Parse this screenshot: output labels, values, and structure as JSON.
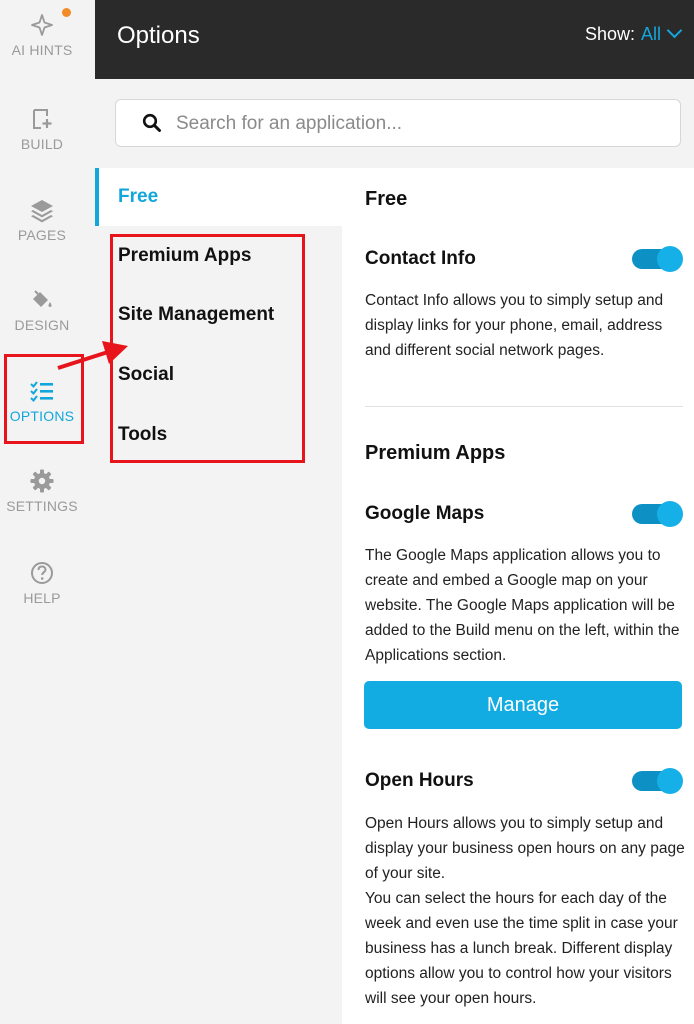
{
  "rail": {
    "items": [
      {
        "label": "AI HINTS",
        "icon": "sparkle-icon"
      },
      {
        "label": "BUILD",
        "icon": "build-plus-icon"
      },
      {
        "label": "PAGES",
        "icon": "layers-icon"
      },
      {
        "label": "DESIGN",
        "icon": "paint-bucket-icon"
      },
      {
        "label": "OPTIONS",
        "icon": "checklist-icon"
      },
      {
        "label": "SETTINGS",
        "icon": "gear-icon"
      },
      {
        "label": "HELP",
        "icon": "help-circle-icon"
      }
    ],
    "active": "OPTIONS",
    "accent_color": "#12a7dc",
    "notification_color": "#f28c28"
  },
  "header": {
    "title": "Options",
    "show_label": "Show:",
    "show_value": "All"
  },
  "search": {
    "placeholder": "Search for an application..."
  },
  "categories": [
    "Free",
    "Premium Apps",
    "Site Management",
    "Social",
    "Tools"
  ],
  "content": {
    "free": {
      "title": "Free",
      "apps": [
        {
          "name": "Contact Info",
          "enabled": true,
          "description": "Contact Info allows you to simply setup and display links for your phone, email, address and different social network pages."
        }
      ]
    },
    "premium": {
      "title": "Premium Apps",
      "apps": [
        {
          "name": "Google Maps",
          "enabled": true,
          "description": "The Google Maps application allows you to create and embed a Google map on your website. The Google Maps application will be added to the Build menu on the left, within the Applications section.",
          "button": "Manage"
        },
        {
          "name": "Open Hours",
          "enabled": true,
          "description_1": "Open Hours allows you to simply setup and display your business open hours on any page of your site.",
          "description_2": "You can select the hours for each day of the week and even use the time split in case your business has a lunch break. Different display options allow you to control how your visitors will see your open hours."
        }
      ]
    }
  },
  "colors": {
    "header_bg": "#2a2a2a",
    "highlight_red": "#e8141c",
    "toggle_on": "#16b0e8",
    "button": "#13ace2"
  }
}
